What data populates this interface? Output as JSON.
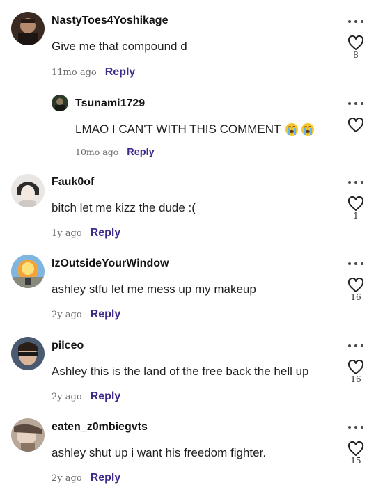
{
  "comments": [
    {
      "username": "NastyToes4Yoshikage",
      "text": "Give me that compound d",
      "time": "11mo ago",
      "reply": "Reply",
      "likes": "8"
    },
    {
      "username": "Tsunami1729",
      "text": "LMAO I CAN'T WITH THIS COMMENT",
      "time": "10mo ago",
      "reply": "Reply",
      "likes": "",
      "emoji_icons": [
        "loudly-crying-face-icon",
        "loudly-crying-face-icon"
      ]
    },
    {
      "username": "Fauk0of",
      "text": "bitch let me kizz the dude :(",
      "time": "1y ago",
      "reply": "Reply",
      "likes": "1"
    },
    {
      "username": "IzOutsideYourWindow",
      "text": "ashley stfu let me mess up my makeup",
      "time": "2y ago",
      "reply": "Reply",
      "likes": "16"
    },
    {
      "username": "pilceo",
      "text": "Ashley this is the land of the free back the hell up",
      "time": "2y ago",
      "reply": "Reply",
      "likes": "16"
    },
    {
      "username": "eaten_z0mbiegvts",
      "text": "ashley shut up i want his freedom fighter.",
      "time": "2y ago",
      "reply": "Reply",
      "likes": "15"
    }
  ],
  "icons": {
    "more": "more-options-icon",
    "like": "heart-icon"
  },
  "colors": {
    "reply": "#3f2a8c",
    "username": "#141414",
    "time": "#6b6b6b"
  }
}
